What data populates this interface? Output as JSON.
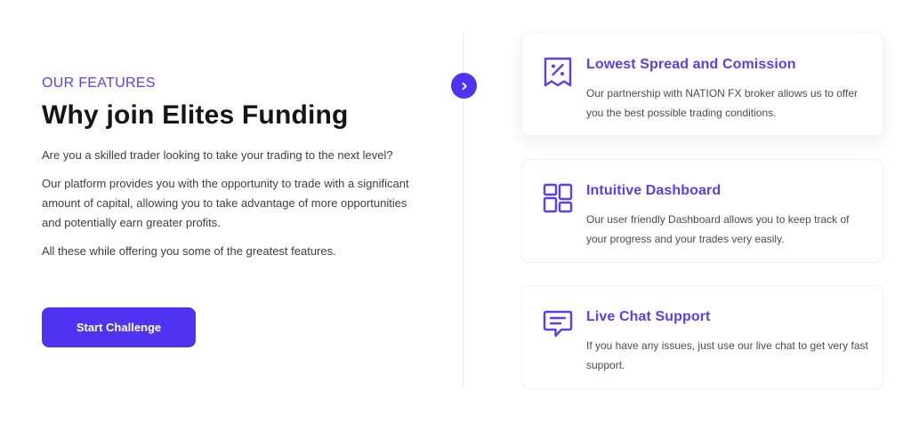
{
  "intro": {
    "eyebrow": "OUR FEATURES",
    "heading": "Why join Elites Funding",
    "paragraphs": [
      "Are you a skilled trader looking to take your trading to the next level?",
      "Our platform provides you with the opportunity to trade with a significant amount of capital, allowing you to take advantage of more opportunities and potentially earn greater profits.",
      "All these while offering you some of the greatest features."
    ],
    "cta_label": "Start Challenge"
  },
  "nav": {
    "icon": "chevron-right-icon"
  },
  "features": [
    {
      "icon": "receipt-percent-icon",
      "title": "Lowest Spread and Comission",
      "description": "Our partnership with NATION FX broker allows us to offer you the best possible trading conditions."
    },
    {
      "icon": "dashboard-grid-icon",
      "title": "Intuitive Dashboard",
      "description": "Our user friendly Dashboard allows you to keep track of your progress and your trades very easily."
    },
    {
      "icon": "chat-bubble-icon",
      "title": "Live Chat Support",
      "description": "If you have any issues, just use our live chat to get very fast support."
    }
  ],
  "colors": {
    "accent": "#5b3df5",
    "button": "#4f33f0",
    "heading": "#14141a",
    "body_text": "#3d3d46",
    "divider": "#ececf1"
  }
}
